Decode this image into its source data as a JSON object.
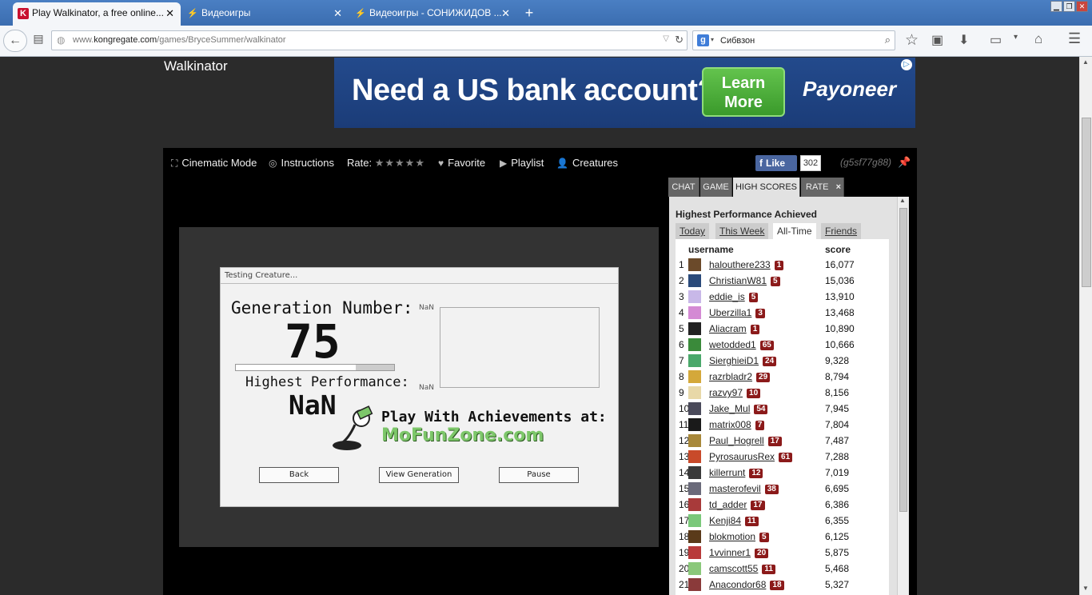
{
  "browser": {
    "tabs": [
      {
        "label": "Play Walkinator, a free online...",
        "active": true
      },
      {
        "label": "Видеоигры",
        "active": false
      },
      {
        "label": "Видеоигры - СОНИЖИДОВ ...",
        "active": false
      }
    ],
    "url_prefix": "www.",
    "url_domain": "kongregate.com",
    "url_path": "/games/BryceSummer/walkinator",
    "search_value": "Сибвзон"
  },
  "page": {
    "game_title": "Walkinator",
    "ad": {
      "headline": "Need a US bank account?",
      "cta": "Learn More",
      "brand": "Payoneer"
    },
    "toolbar": {
      "cinematic": "Cinematic Mode",
      "instructions": "Instructions",
      "rate": "Rate:",
      "stars": "★★★★★",
      "favorite": "Favorite",
      "playlist": "Playlist",
      "creatures": "Creatures",
      "fb_like": "Like",
      "fb_count": "302",
      "user_code": "(g5sf77g88)"
    },
    "game": {
      "dialog_title": "Testing Creature...",
      "gen_label": "Generation Number:",
      "gen_number": "75",
      "gen_progress": 0.76,
      "hp_label": "Highest Performance:",
      "hp_value": "NaN",
      "graph_top": "NaN",
      "graph_bottom": "NaN",
      "achv_text": "Play With Achievements at:",
      "achv_site": "MoFunZone.com",
      "btn_back": "Back",
      "btn_view": "View Generation",
      "btn_pause": "Pause"
    },
    "side_tabs": [
      "CHAT",
      "GAME",
      "HIGH SCORES",
      "RATE"
    ],
    "side_tab_close": "×",
    "scores": {
      "heading": "Highest Performance Achieved",
      "periods": [
        "Today",
        "This Week",
        "All-Time",
        "Friends"
      ],
      "col_user": "username",
      "col_score": "score",
      "rows": [
        {
          "rank": "1",
          "name": "halouthere233",
          "level": "1",
          "score": "16,077",
          "color": "#6b4a2a"
        },
        {
          "rank": "2",
          "name": "ChristianW81",
          "level": "5",
          "score": "15,036",
          "color": "#2a4a7a"
        },
        {
          "rank": "3",
          "name": "eddie_is",
          "level": "5",
          "score": "13,910",
          "color": "#c8b8e8"
        },
        {
          "rank": "4",
          "name": "Uberzilla1",
          "level": "3",
          "score": "13,468",
          "color": "#d48ad4"
        },
        {
          "rank": "5",
          "name": "Aliacram",
          "level": "1",
          "score": "10,890",
          "color": "#222222"
        },
        {
          "rank": "6",
          "name": "wetodded1",
          "level": "65",
          "score": "10,666",
          "color": "#3a8a3a"
        },
        {
          "rank": "7",
          "name": "SierghieiD1",
          "level": "24",
          "score": "9,328",
          "color": "#4aa86a"
        },
        {
          "rank": "8",
          "name": "razrbladr2",
          "level": "29",
          "score": "8,794",
          "color": "#d4a83a"
        },
        {
          "rank": "9",
          "name": "razvy97",
          "level": "10",
          "score": "8,156",
          "color": "#e8d8a8"
        },
        {
          "rank": "10",
          "name": "Jake_Mul",
          "level": "54",
          "score": "7,945",
          "color": "#4a4a5a"
        },
        {
          "rank": "11",
          "name": "matrix008",
          "level": "7",
          "score": "7,804",
          "color": "#1a1a1a"
        },
        {
          "rank": "12",
          "name": "Paul_Hogrell",
          "level": "17",
          "score": "7,487",
          "color": "#a8883a"
        },
        {
          "rank": "13",
          "name": "PyrosaurusRex",
          "level": "61",
          "score": "7,288",
          "color": "#c84a2a"
        },
        {
          "rank": "14",
          "name": "killerrunt",
          "level": "12",
          "score": "7,019",
          "color": "#3a3a3a"
        },
        {
          "rank": "15",
          "name": "masterofevil",
          "level": "38",
          "score": "6,695",
          "color": "#6a6a7a"
        },
        {
          "rank": "16",
          "name": "td_adder",
          "level": "17",
          "score": "6,386",
          "color": "#a83a3a"
        },
        {
          "rank": "17",
          "name": "Kenji84",
          "level": "11",
          "score": "6,355",
          "color": "#7ac87a"
        },
        {
          "rank": "18",
          "name": "blokmotion",
          "level": "5",
          "score": "6,125",
          "color": "#5a3a1a"
        },
        {
          "rank": "19",
          "name": "1vvinner1",
          "level": "20",
          "score": "5,875",
          "color": "#b83a3a"
        },
        {
          "rank": "20",
          "name": "camscott55",
          "level": "11",
          "score": "5,468",
          "color": "#8ac87a"
        },
        {
          "rank": "21",
          "name": "Anacondor68",
          "level": "18",
          "score": "5,327",
          "color": "#8a3a3a"
        }
      ]
    }
  },
  "colors": {
    "accent": "#c8102e",
    "facebook": "#4a66a0",
    "level_badge": "#8b1a1a",
    "ad_green": "#3a9a2b"
  }
}
